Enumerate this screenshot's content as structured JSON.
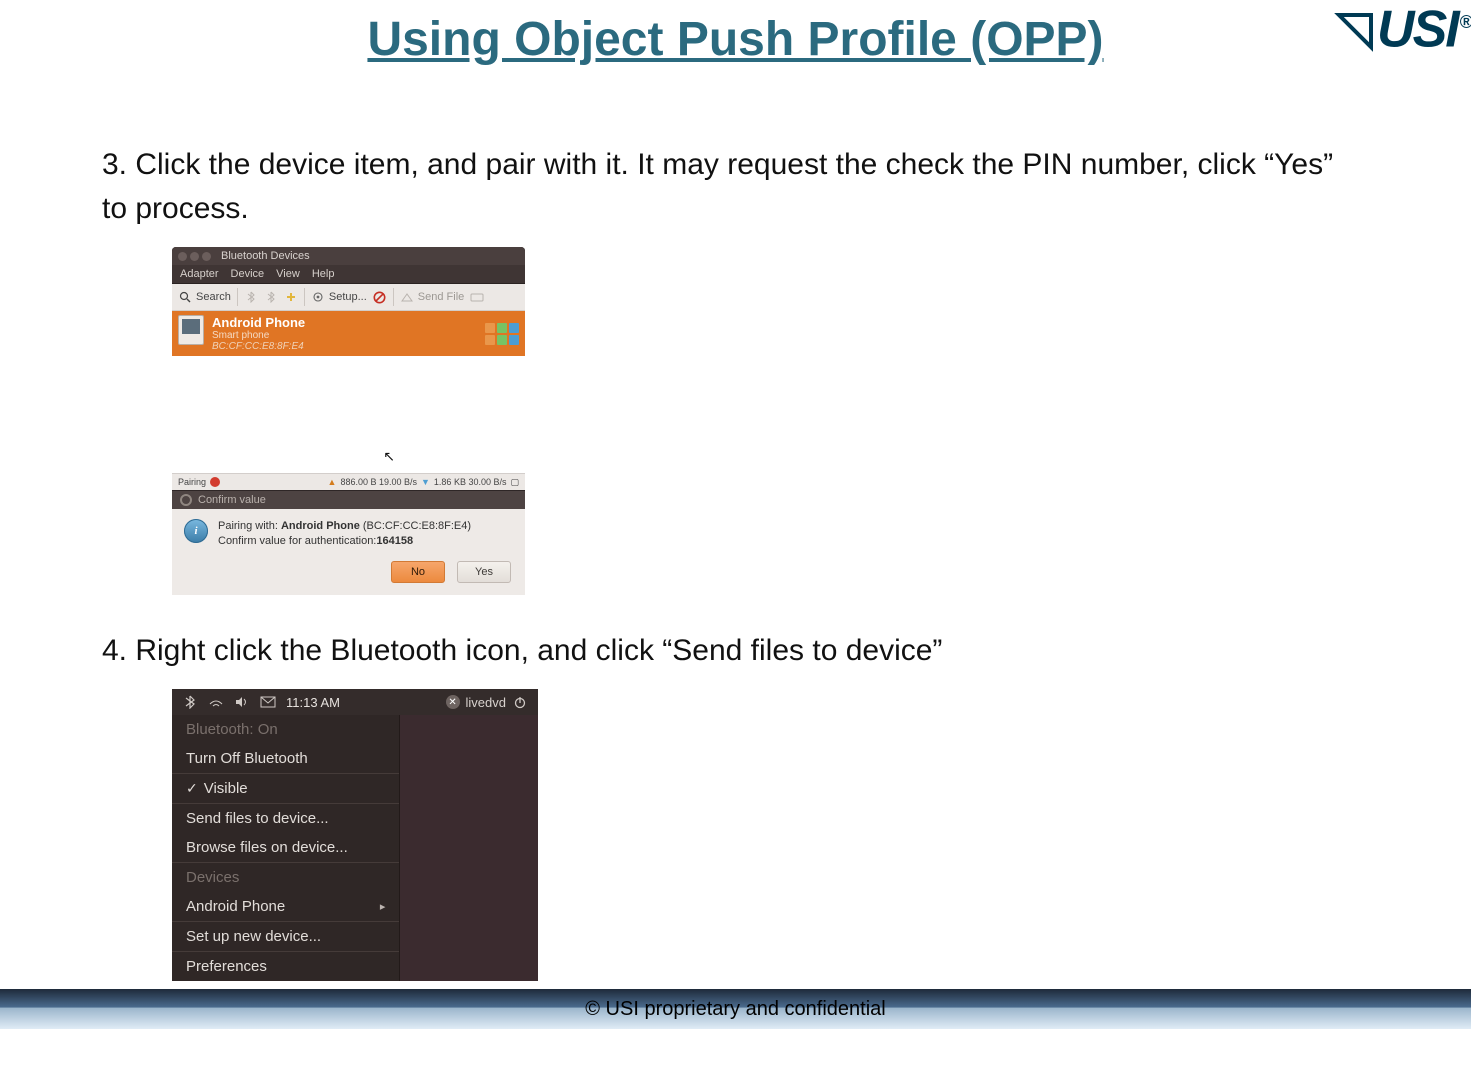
{
  "page_title": "Using Object Push Profile (OPP)",
  "logo_text": "USI",
  "logo_reg": "®",
  "step3_text": "3. Click the device item, and pair with it. It may request the check the PIN number, click “Yes” to process.",
  "step4_text": "4. Right click the Bluetooth icon, and click “Send files to device”",
  "footer": "© USI proprietary and confidential",
  "bt": {
    "window_title": "Bluetooth Devices",
    "menus": {
      "adapter": "Adapter",
      "device": "Device",
      "view": "View",
      "help": "Help"
    },
    "toolbar": {
      "search": "Search",
      "setup": "Setup...",
      "sendfile": "Send File"
    },
    "device": {
      "name": "Android Phone",
      "subtype": "Smart phone",
      "mac": "BC:CF:CC:E8:8F:E4"
    },
    "status": {
      "left_label": "Pairing",
      "up": "886.00 B 19.00 B/s",
      "down": "1.86 KB 30.00 B/s"
    },
    "confirm": {
      "title": "Confirm value",
      "line1_a": "Pairing with: ",
      "line1_b": "Android Phone",
      "line1_c": " (BC:CF:CC:E8:8F:E4)",
      "line2_a": "Confirm value for authentication:",
      "line2_b": "164158",
      "no": "No",
      "yes": "Yes"
    }
  },
  "tray": {
    "clock": "11:13 AM",
    "user": "livedvd",
    "items": {
      "bt_on": "Bluetooth: On",
      "turn_off": "Turn Off Bluetooth",
      "visible": "Visible",
      "send_files": "Send files to device...",
      "browse_files": "Browse files on device...",
      "devices_header": "Devices",
      "android": "Android Phone",
      "setup_new": "Set up new device...",
      "preferences": "Preferences"
    }
  }
}
